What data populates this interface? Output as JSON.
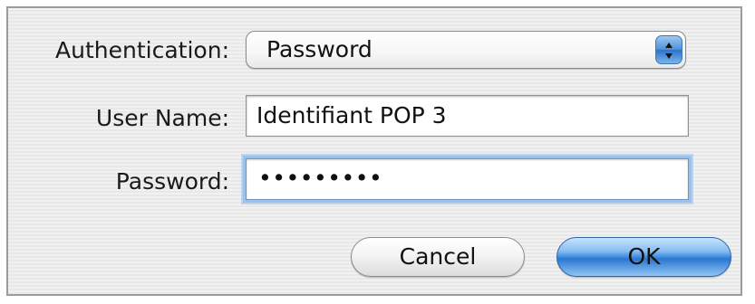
{
  "dialog": {
    "authentication_label": "Authentication:",
    "authentication_value": "Password",
    "user_name_label": "User Name:",
    "user_name_value": "Identifiant POP 3",
    "password_label": "Password:",
    "password_value": "•••••••••",
    "cancel_label": "Cancel",
    "ok_label": "OK"
  },
  "icons": {
    "popup_arrows": "up-down-chevron-icon"
  },
  "colors": {
    "focus_ring": "#9cc2ec",
    "default_button": "#3f8de0"
  }
}
